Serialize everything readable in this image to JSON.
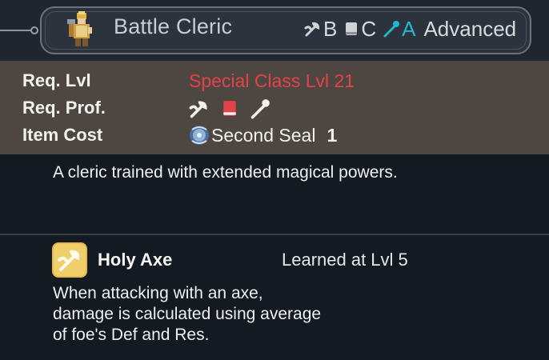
{
  "header": {
    "class_name": "Battle Cleric",
    "sprite_icon": "battle-cleric-sprite",
    "ranks": [
      {
        "icon": "axe-icon",
        "letter": "B"
      },
      {
        "icon": "tome-icon",
        "letter": "C"
      },
      {
        "icon": "staff-icon",
        "letter": "A"
      }
    ],
    "tier": "Advanced"
  },
  "requirements": {
    "level_label": "Req. Lvl",
    "level_value": "Special Class Lvl 21",
    "prof_label": "Req. Prof.",
    "prof_icons": [
      "axe-icon",
      "tome-icon",
      "staff-icon"
    ],
    "cost_label": "Item Cost",
    "cost_item": "Second Seal",
    "cost_count": "1"
  },
  "description": "A cleric trained with extended magical powers.",
  "skill": {
    "icon": "holy-axe-icon",
    "name": "Holy Axe",
    "learn": "Learned at Lvl 5",
    "description_lines": [
      "When attacking with an axe,",
      "damage is calculated using average",
      "of foe's Def and Res."
    ]
  },
  "colors": {
    "header_bg": "#20262e",
    "req_bg": "#4e4741",
    "body_bg": "#141a22",
    "highlight_red": "#e2434b",
    "staff_rank_teal": "#1fb9c8",
    "skill_icon_gold": "#f0cf6a"
  }
}
